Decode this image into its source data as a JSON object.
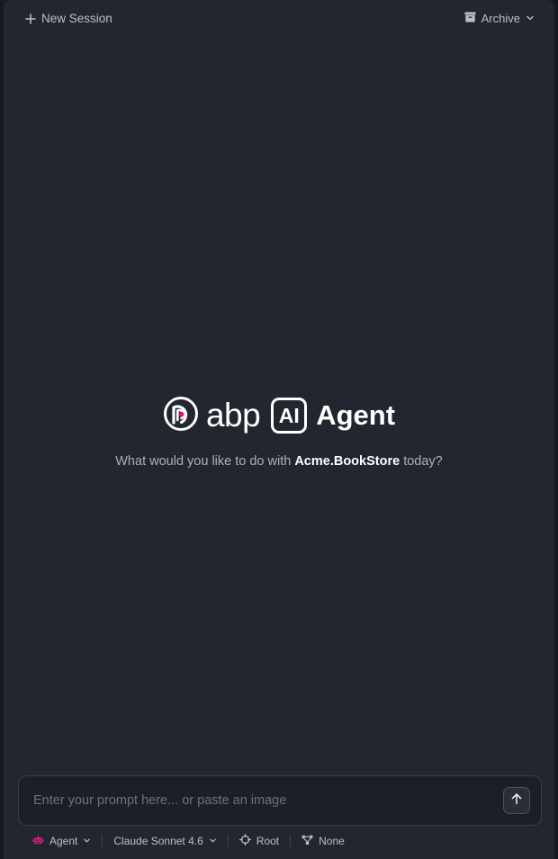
{
  "header": {
    "new_session_label": "New Session",
    "archive_label": "Archive"
  },
  "hero": {
    "brand_word": "abp",
    "ai_badge": "AI",
    "agent_word": "Agent",
    "subtitle_prefix": "What would you like to do with",
    "project_name": "Acme.BookStore",
    "subtitle_suffix": "today?"
  },
  "prompt": {
    "placeholder": "Enter your prompt here... or paste an image",
    "value": ""
  },
  "toolbar": {
    "mode_label": "Agent",
    "model_label": "Claude Sonnet 4.6",
    "scope_label": "Root",
    "context_label": "None"
  },
  "colors": {
    "panel_bg": "#22262e",
    "page_bg": "#17191d",
    "text_muted": "#b9c0cb",
    "brand_accent": "#e0117a",
    "agent_icon": "#e0117a"
  },
  "icons": {
    "new_session": "plus-icon",
    "archive": "archive-box-icon",
    "archive_dropdown": "chevron-down-icon",
    "send": "arrow-up-icon",
    "mode": "robot-icon",
    "scope": "crosshair-icon",
    "context": "network-icon"
  }
}
